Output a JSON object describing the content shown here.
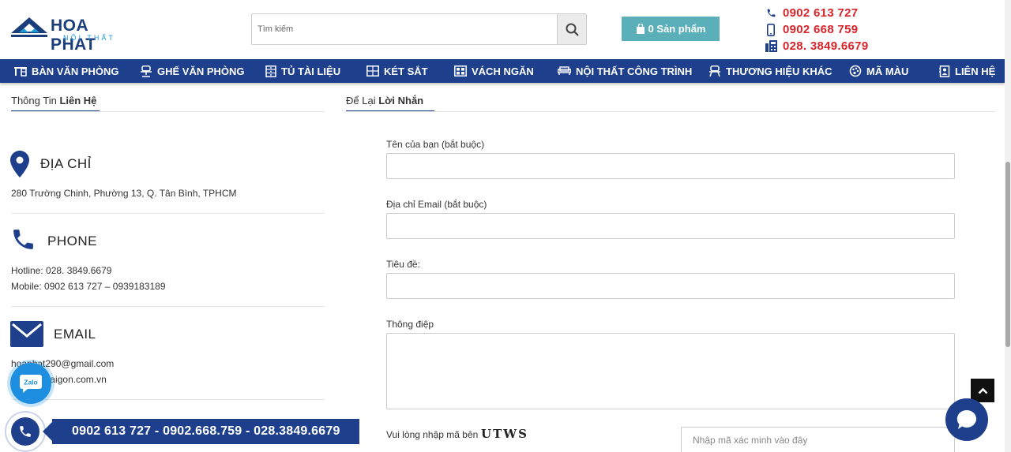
{
  "brand": {
    "name": "HOA PHAT",
    "sub": "NỘI THẤT"
  },
  "search": {
    "placeholder": "Tìm kiếm"
  },
  "cart": {
    "label": "0 Sản phẩm"
  },
  "hotlines": [
    "0902 613 727",
    "0902 668 759",
    "028. 3849.6679"
  ],
  "nav": [
    {
      "label": "BÀN VĂN PHÒNG",
      "icon": "desk-icon"
    },
    {
      "label": "GHẾ VĂN PHÒNG",
      "icon": "chair-icon"
    },
    {
      "label": "TỦ TÀI LIỆU",
      "icon": "cabinet-icon"
    },
    {
      "label": "KÉT SẮT",
      "icon": "safe-icon"
    },
    {
      "label": "VÁCH NGĂN",
      "icon": "partition-icon"
    },
    {
      "label": "NỘI THẤT CÔNG TRÌNH",
      "icon": "sofa-icon"
    },
    {
      "label": "THƯƠNG HIỆU KHÁC",
      "icon": "brand-icon"
    },
    {
      "label": "MÃ MÀU",
      "icon": "palette-icon"
    },
    {
      "label": "LIÊN HỆ",
      "icon": "contact-icon"
    }
  ],
  "contact": {
    "tab": {
      "prefix": "Thông Tin ",
      "bold": "Liên Hệ"
    },
    "address": {
      "title": "ĐỊA CHỈ",
      "text": "280 Trường Chinh, Phường 13, Q. Tân Bình, TPHCM"
    },
    "phone": {
      "title": "PHONE",
      "hotline": "Hotline: 028. 3849.6679",
      "mobile": "Mobile: 0902 613 727 – 0939183189"
    },
    "email": {
      "title": "EMAIL",
      "email1": "hoaphat290@gmail.com",
      "email2": "hoaphatsaigon.com.vn"
    }
  },
  "form": {
    "tab": {
      "prefix": "Để Lại ",
      "bold": "Lời Nhắn"
    },
    "name_label": "Tên của bạn (bắt buộc)",
    "email_label": "Địa chỉ Email (bắt buộc)",
    "subject_label": "Tiêu đề:",
    "message_label": "Thông điệp",
    "captcha_label": "Vui lòng nhập mã bên",
    "captcha_code": "UTWS",
    "captcha_placeholder": "Nhập mã xác minh vào đây"
  },
  "floating": {
    "zalo": "Zalo",
    "hotline_bar": "0902 613 727 - 0902.668.759 - 028.3849.6679"
  },
  "colors": {
    "primary": "#1e3f8c",
    "hotline_red": "#d9242a",
    "cart_teal": "#5aafb8",
    "zalo": "#1d8ee0"
  }
}
